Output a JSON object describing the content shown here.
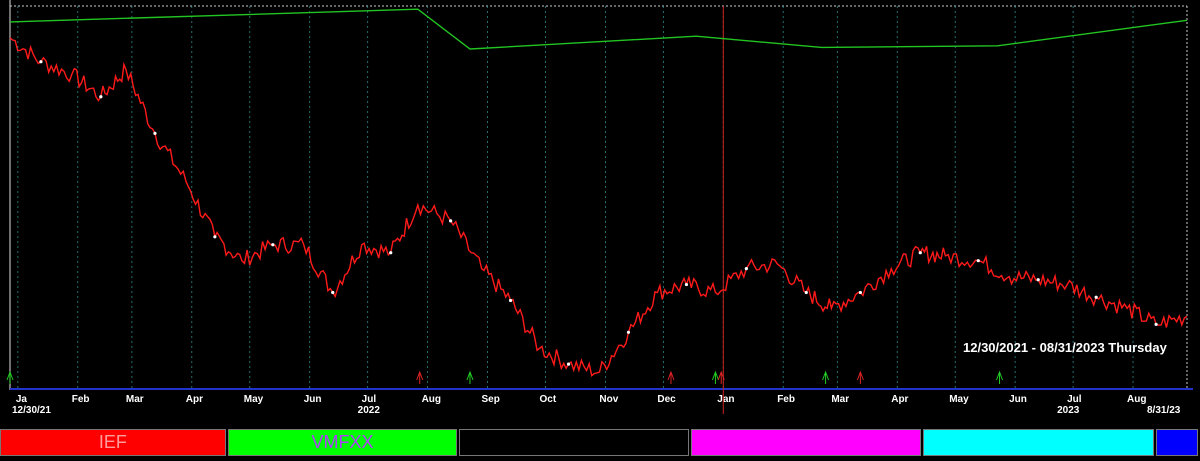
{
  "chart_data": {
    "type": "line",
    "range_label": "12/30/2021 - 08/31/2023 Thursday",
    "start_date_label": "12/30/21",
    "end_date_label": "8/31/23",
    "month_labels": [
      "Ja",
      "Feb",
      "Mar",
      "Apr",
      "May",
      "Jun",
      "Jul",
      "Aug",
      "Sep",
      "Oct",
      "Nov",
      "Dec",
      "Jan",
      "Feb",
      "Mar",
      "Apr",
      "May",
      "Jun",
      "Jul",
      "Aug"
    ],
    "year_labels": [
      "2022",
      "2023"
    ],
    "series": [
      {
        "name": "IEF",
        "color": "#ff1a1a",
        "x": [
          "2021-12-30",
          "2022-01-15",
          "2022-01-31",
          "2022-02-15",
          "2022-02-28",
          "2022-03-15",
          "2022-03-31",
          "2022-04-15",
          "2022-04-29",
          "2022-05-15",
          "2022-05-31",
          "2022-06-15",
          "2022-06-30",
          "2022-07-15",
          "2022-07-29",
          "2022-08-15",
          "2022-08-31",
          "2022-09-15",
          "2022-09-30",
          "2022-10-15",
          "2022-10-31",
          "2022-11-15",
          "2022-11-30",
          "2022-12-15",
          "2022-12-30",
          "2023-01-15",
          "2023-01-31",
          "2023-02-15",
          "2023-02-28",
          "2023-03-15",
          "2023-03-31",
          "2023-04-15",
          "2023-04-28",
          "2023-05-15",
          "2023-05-31",
          "2023-06-15",
          "2023-06-30",
          "2023-07-15",
          "2023-07-31",
          "2023-08-15",
          "2023-08-31"
        ],
        "values": [
          114.5,
          113.0,
          112.2,
          110.8,
          112.5,
          108.5,
          105.5,
          102.0,
          100.5,
          101.5,
          101.5,
          98.5,
          101.5,
          101.0,
          104.0,
          103.0,
          100.0,
          98.0,
          95.0,
          94.0,
          93.5,
          96.0,
          98.5,
          99.0,
          98.5,
          100.0,
          100.3,
          98.5,
          97.5,
          98.5,
          100.0,
          101.0,
          100.8,
          100.5,
          99.5,
          99.3,
          99.0,
          98.2,
          97.5,
          96.5,
          97.0
        ]
      },
      {
        "name": "VMFXX",
        "color": "#22c422",
        "x": [
          "2021-12-30",
          "2022-07-29",
          "2022-08-25",
          "2022-12-20",
          "2023-02-23",
          "2023-05-25",
          "2023-08-31"
        ],
        "values": [
          115.5,
          116.3,
          113.8,
          114.6,
          113.9,
          114.0,
          115.6
        ]
      }
    ],
    "grid": true,
    "legend": [
      "IEF",
      "VMFXX",
      "",
      "",
      "",
      ""
    ],
    "legend_colors": [
      "#ff0000",
      "#00ff00",
      "#000000",
      "#ff00ff",
      "#00ffff",
      "#0000ff"
    ],
    "legend_text_colors": [
      "#ff9d9d",
      "#b03cff",
      "#000000",
      "#000000",
      "#000000",
      "#000000"
    ],
    "ylim": [
      92.5,
      116.5
    ]
  }
}
